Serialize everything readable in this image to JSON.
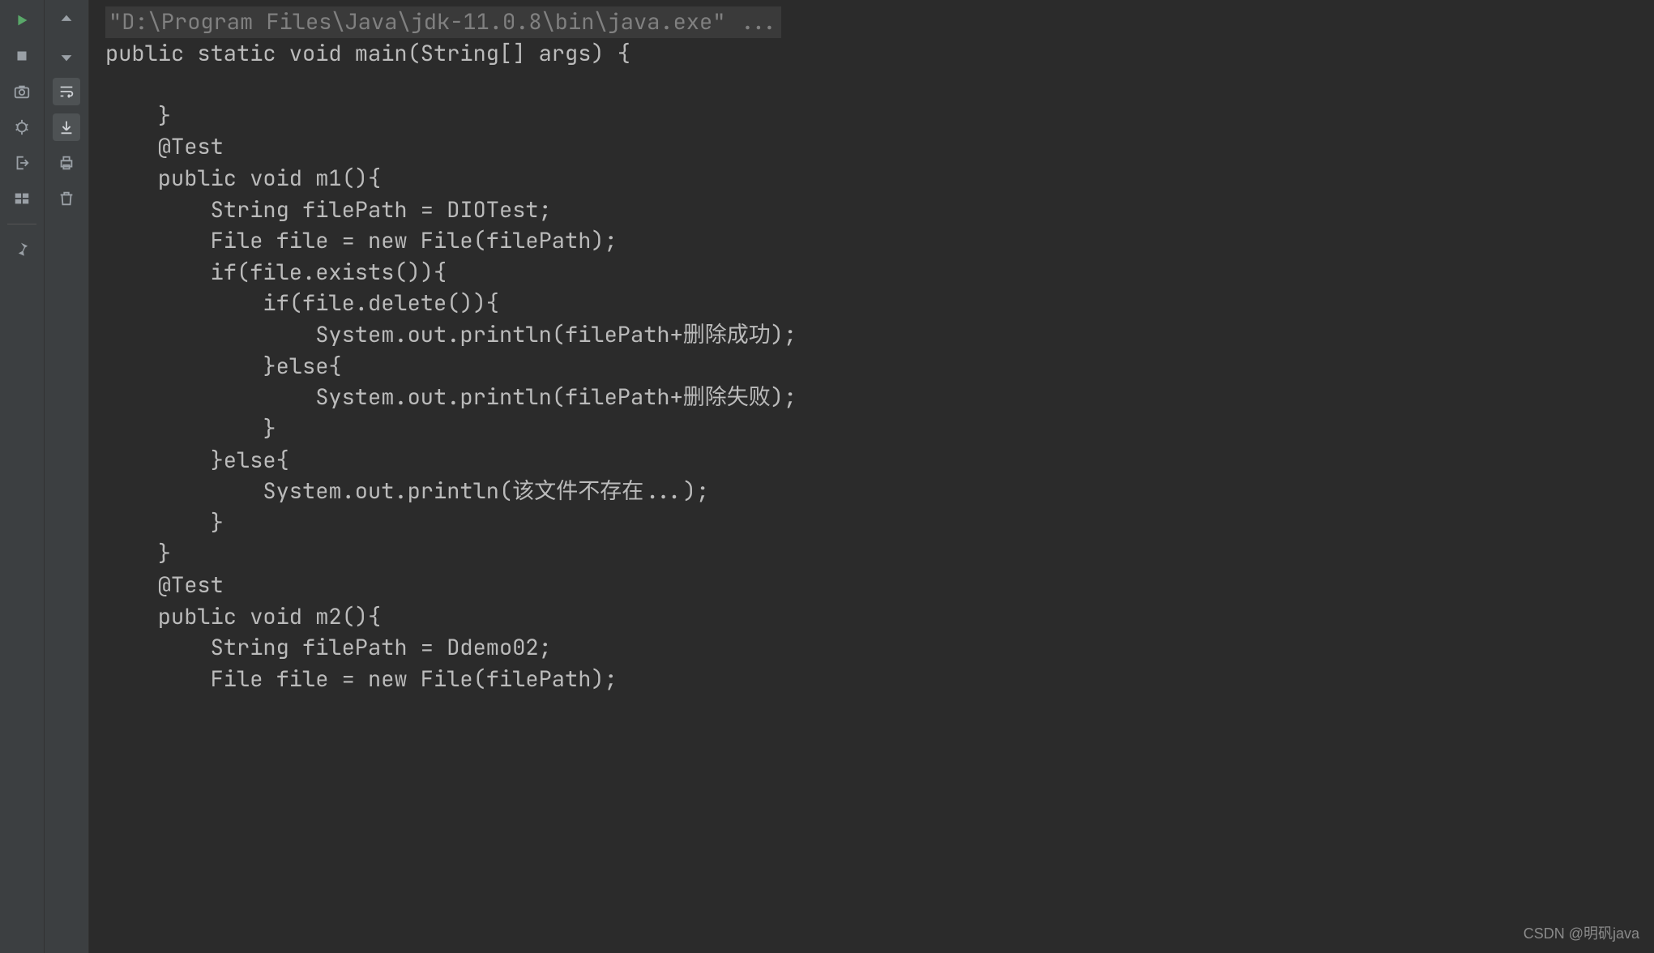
{
  "toolbar_left": {
    "run": "run-icon",
    "stop": "stop-icon",
    "camera": "camera-icon",
    "debug_bug": "debug-icon",
    "exit": "exit-icon",
    "layout": "layout-icon",
    "pin": "pin-icon"
  },
  "toolbar_right": {
    "up": "up-arrow-icon",
    "down": "down-arrow-icon",
    "wrap": "soft-wrap-icon",
    "scroll_end": "scroll-to-end-icon",
    "print": "print-icon",
    "trash": "trash-icon"
  },
  "console": {
    "cmd": "\"D:\\Program Files\\Java\\jdk-11.0.8\\bin\\java.exe\" ...",
    "lines": [
      "public static void main(String[] args) {",
      "",
      "    }",
      "    @Test",
      "    public void m1(){",
      "        String filePath = DIOTest;",
      "        File file = new File(filePath);",
      "        if(file.exists()){",
      "            if(file.delete()){",
      "                System.out.println(filePath+删除成功);",
      "            }else{",
      "                System.out.println(filePath+删除失败);",
      "            }",
      "        }else{",
      "            System.out.println(该文件不存在...);",
      "        }",
      "    }",
      "    @Test",
      "    public void m2(){",
      "        String filePath = Ddemo02;",
      "        File file = new File(filePath);"
    ]
  },
  "watermark": "CSDN @明矾java"
}
